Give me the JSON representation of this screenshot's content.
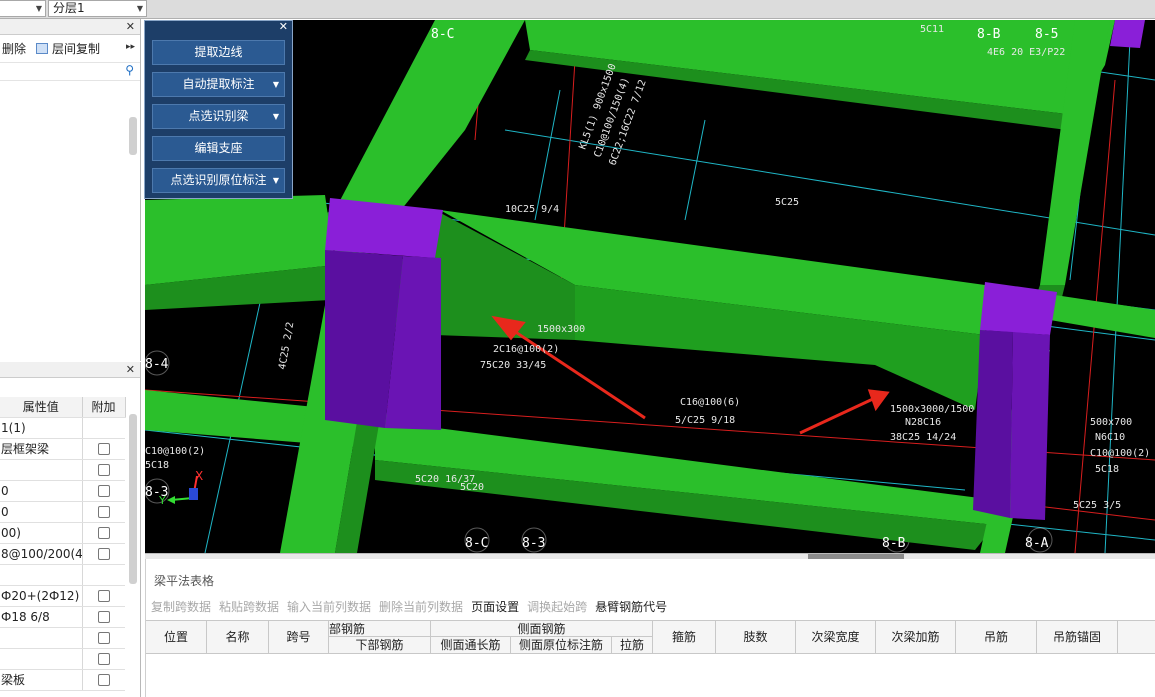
{
  "topbar": {
    "combo_left_value": "",
    "floor_combo_value": "分层1"
  },
  "component_panel": {
    "toolbar": {
      "delete_label": "删除",
      "copy_between_floors_label": "层间复制"
    },
    "search_placeholder": ""
  },
  "property_panel": {
    "headers": {
      "value": "属性值",
      "extra": "附加"
    },
    "rows": [
      {
        "value": "1(1)",
        "checkbox": false
      },
      {
        "value": "层框架梁",
        "checkbox": true
      },
      {
        "value": "",
        "checkbox": true
      },
      {
        "value": "0",
        "checkbox": true
      },
      {
        "value": "0",
        "checkbox": true
      },
      {
        "value": "00)",
        "checkbox": true
      },
      {
        "value": "8@100/200(4)",
        "checkbox": true
      },
      {
        "value": "",
        "checkbox": false
      },
      {
        "value": "Ф20+(2Ф12)",
        "checkbox": true
      },
      {
        "value": "Ф18 6/8",
        "checkbox": true
      },
      {
        "value": "",
        "checkbox": true
      },
      {
        "value": "",
        "checkbox": true
      },
      {
        "value": "梁板",
        "checkbox": true
      }
    ]
  },
  "palette": {
    "buttons": [
      {
        "label": "提取边线",
        "dropdown": false
      },
      {
        "label": "自动提取标注",
        "dropdown": true
      },
      {
        "label": "点选识别梁",
        "dropdown": true
      },
      {
        "label": "编辑支座",
        "dropdown": false
      },
      {
        "label": "点选识别原位标注",
        "dropdown": true
      }
    ]
  },
  "viewport": {
    "axis_labels": [
      "8-C",
      "8-B",
      "8-5",
      "8-4",
      "8-3",
      "8-C",
      "8-3",
      "8-B",
      "8-A"
    ],
    "cad_texts": [
      "5C11",
      "4E6 20 E3/P22",
      "KL5(1) 900x1500",
      "C10@100/150(4)",
      "6C22;16C22 7/12",
      "10C25 9/4",
      "5C25",
      "4C25 2/2",
      "1500x300",
      "2C16@100(2)",
      "75C20 33/45",
      "C16@100(6)",
      "5/C25 9/18",
      "1500x3000/1500",
      "N28C16",
      "38C25 14/24",
      "500x700",
      "N6C10",
      "C10@100(2)",
      "5C18",
      "5C25 3/5",
      "5C20 16/37",
      "5C20",
      "5C18",
      "C10@100(2)"
    ],
    "gizmo": {
      "x_label": "X",
      "y_label": "Y"
    },
    "colors": {
      "beam": "#2bbf2b",
      "column": "#8a1fd8",
      "arrow": "#e8281c",
      "grid_line": "#1fb6c6",
      "axis_line": "#d81e1e"
    }
  },
  "beam_table": {
    "title": "梁平法表格",
    "toolbar": [
      {
        "label": "复制跨数据",
        "enabled": false
      },
      {
        "label": "粘贴跨数据",
        "enabled": false
      },
      {
        "label": "输入当前列数据",
        "enabled": false
      },
      {
        "label": "删除当前列数据",
        "enabled": false
      },
      {
        "label": "页面设置",
        "enabled": true
      },
      {
        "label": "调换起始跨",
        "enabled": false
      },
      {
        "label": "悬臂钢筋代号",
        "enabled": true
      }
    ],
    "columns": {
      "position": "位置",
      "name": "名称",
      "span": "跨号",
      "bottom_group": "部钢筋",
      "bottom_rebar": "下部钢筋",
      "side_group": "侧面钢筋",
      "side_through": "侧面通长筋",
      "side_inplace": "侧面原位标注筋",
      "tie": "拉筋",
      "stirrup": "箍筋",
      "legs": "肢数",
      "secondary_width": "次梁宽度",
      "secondary_extra": "次梁加筋",
      "hanger": "吊筋",
      "hanger_anchor": "吊筋锚固"
    }
  }
}
